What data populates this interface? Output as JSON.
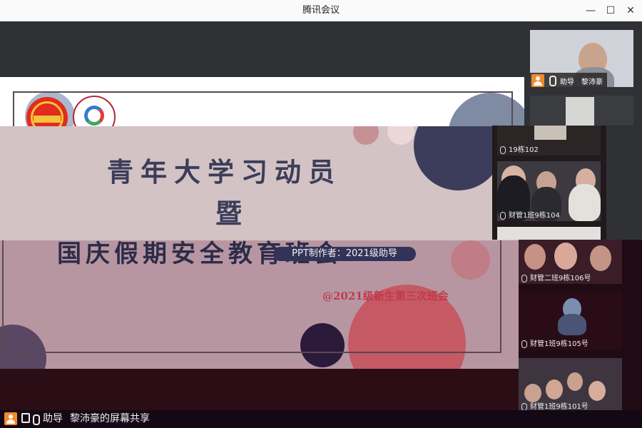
{
  "window": {
    "title": "腾讯会议",
    "minimize_glyph": "—",
    "maximize_glyph": "☐",
    "close_glyph": "✕"
  },
  "slide": {
    "title_line1": "青年大学习动员",
    "title_line2": "暨",
    "title_line3": "国庆假期安全教育班会",
    "author": "PPT制作者：2021级助导",
    "stamp": "@2021级新生第三次班会",
    "colors": {
      "pink_band": "#d3c3c4",
      "mauve_band": "#b796a2",
      "title": "#3c3d5a",
      "stamp": "#c03a4c"
    }
  },
  "participants": [
    {
      "role": "助导",
      "name": "黎沛豪",
      "host": true
    },
    {
      "name": ""
    },
    {
      "name": "19栋102"
    },
    {
      "name": "财管1班9栋104"
    },
    {
      "name": ""
    },
    {
      "name": "财管二班9栋106号"
    },
    {
      "name": "财管1班9栋105号"
    },
    {
      "name": "财管1班9栋101号"
    }
  ],
  "bottom": {
    "role": "助导",
    "share_text": "黎沛豪的屏幕共享",
    "accent": "#f08a2c"
  }
}
